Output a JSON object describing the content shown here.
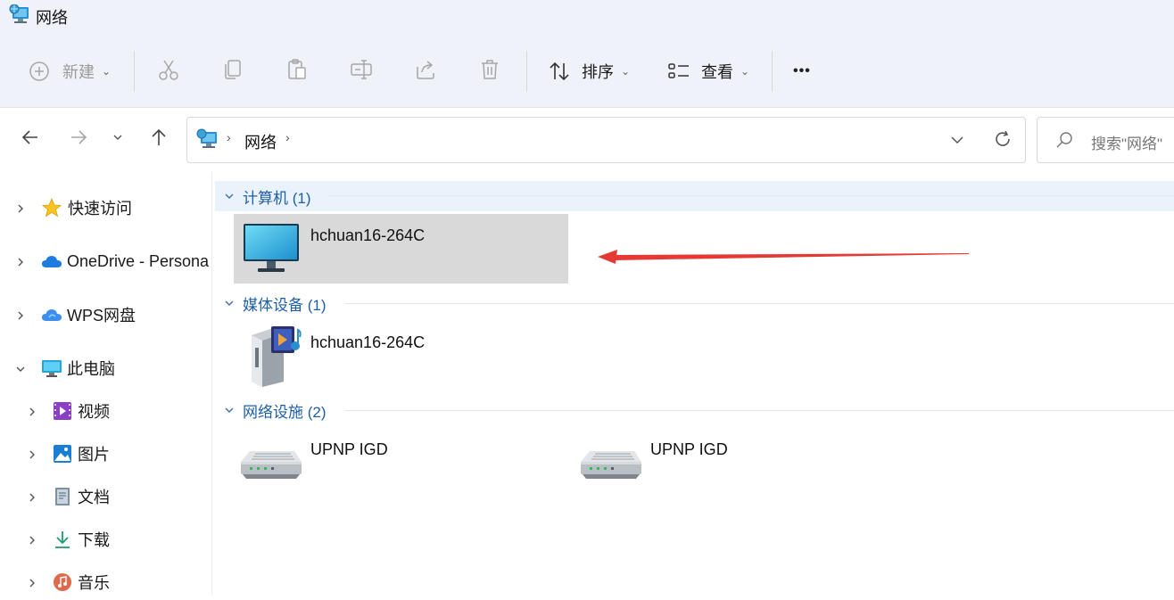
{
  "window": {
    "title": "网络"
  },
  "toolbar": {
    "new_label": "新建",
    "sort_label": "排序",
    "view_label": "查看",
    "more_label": "•••"
  },
  "address": {
    "crumb": "网络",
    "search_placeholder": "搜索\"网络\""
  },
  "sidebar": {
    "items": [
      {
        "label": "快速访问"
      },
      {
        "label": "OneDrive - Persona"
      },
      {
        "label": "WPS网盘"
      },
      {
        "label": "此电脑"
      },
      {
        "label": "视频"
      },
      {
        "label": "图片"
      },
      {
        "label": "文档"
      },
      {
        "label": "下载"
      },
      {
        "label": "音乐"
      }
    ]
  },
  "groups": [
    {
      "title": "计算机 (1)",
      "items": [
        {
          "label": "hchuan16-264C",
          "icon": "monitor-icon"
        }
      ]
    },
    {
      "title": "媒体设备 (1)",
      "items": [
        {
          "label": "hchuan16-264C",
          "icon": "media-device-icon"
        }
      ]
    },
    {
      "title": "网络设施 (2)",
      "items": [
        {
          "label": "UPNP IGD",
          "icon": "router-icon"
        },
        {
          "label": "UPNP IGD",
          "icon": "router-icon"
        }
      ]
    }
  ],
  "colors": {
    "accent": "#1e5fa8",
    "selection": "#d9d9d9",
    "annotation_arrow": "#e53935"
  }
}
